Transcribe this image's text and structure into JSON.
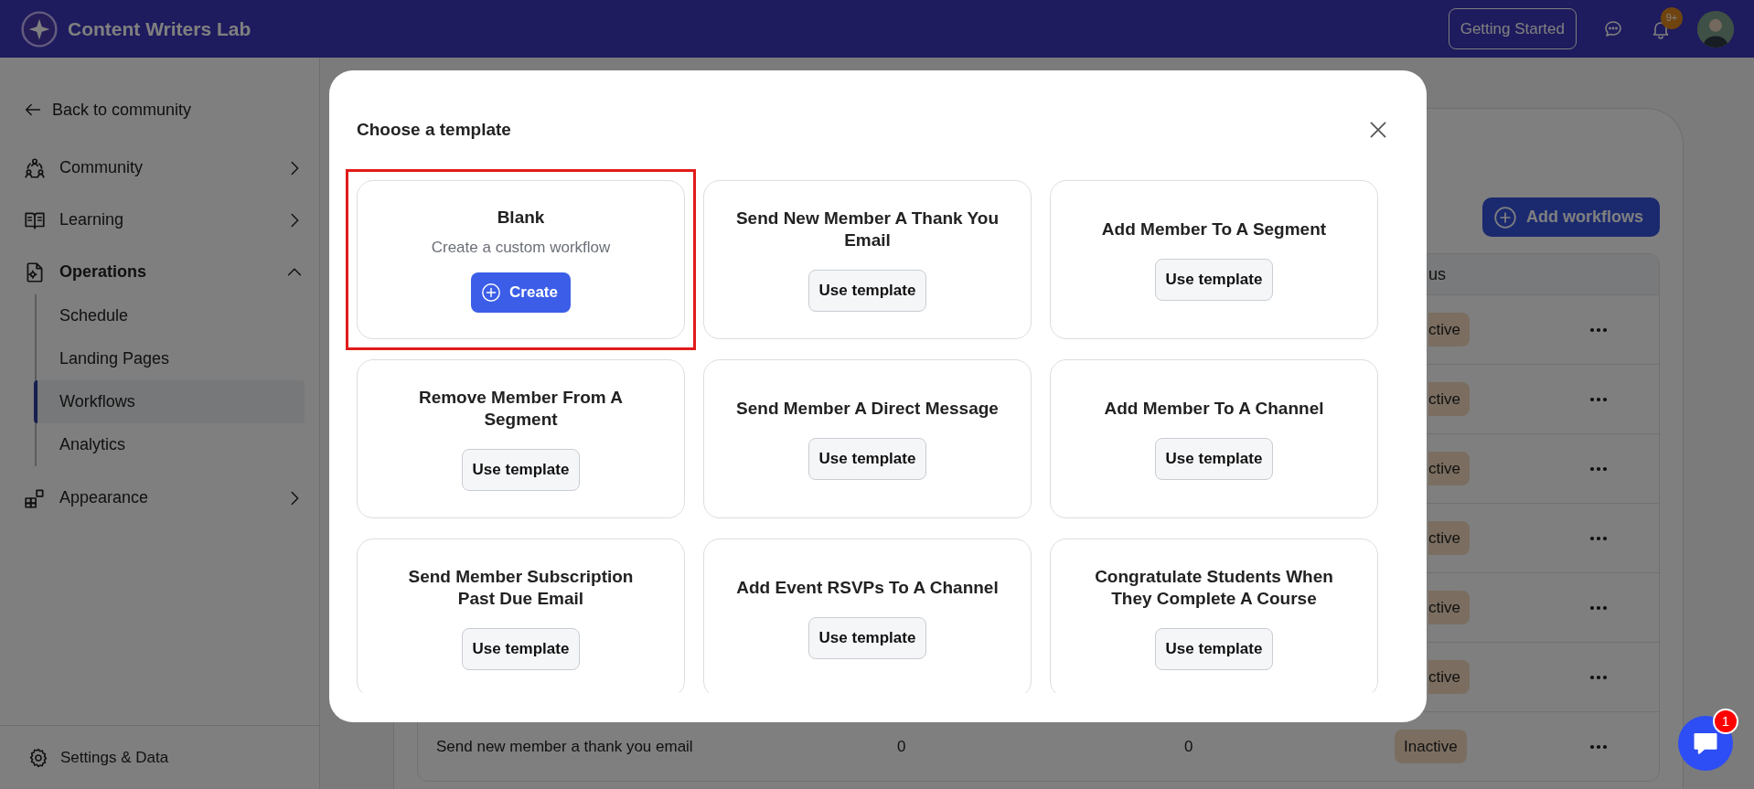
{
  "topbar": {
    "title": "Content Writers Lab",
    "getting_started": "Getting Started",
    "notification_count": "9+"
  },
  "sidebar": {
    "back": "Back to community",
    "items": [
      {
        "label": "Community",
        "expanded": false
      },
      {
        "label": "Learning",
        "expanded": false
      },
      {
        "label": "Operations",
        "expanded": true,
        "children": [
          {
            "label": "Schedule",
            "selected": false
          },
          {
            "label": "Landing Pages",
            "selected": false
          },
          {
            "label": "Workflows",
            "selected": true
          },
          {
            "label": "Analytics",
            "selected": false
          }
        ]
      },
      {
        "label": "Appearance",
        "expanded": false
      }
    ],
    "footer": "Settings & Data"
  },
  "workflows_page": {
    "add_button": "Add workflows",
    "table": {
      "status_header": {
        "label": "us",
        "clipped": true
      },
      "rows": [
        {
          "status": "ctive",
          "clipped": true
        },
        {
          "status": "ctive",
          "clipped": true
        },
        {
          "status": "ctive",
          "clipped": true
        },
        {
          "status": "ctive",
          "clipped": true
        },
        {
          "status": "ctive",
          "clipped": true
        },
        {
          "status": "ctive",
          "clipped": true
        },
        {
          "name": "Send new member a thank you email",
          "column_2": "0",
          "column_3": "0",
          "status": "Inactive",
          "clipped": false
        }
      ]
    }
  },
  "modal": {
    "title": "Choose a template",
    "templates": [
      {
        "kind": "blank",
        "title": "Blank",
        "description": "Create a custom workflow",
        "button": "Create",
        "highlighted": true
      },
      {
        "kind": "template",
        "title": "Send New Member A Thank You Email",
        "button": "Use template",
        "highlighted": false
      },
      {
        "kind": "template",
        "title": "Add Member To A Segment",
        "button": "Use template",
        "highlighted": false
      },
      {
        "kind": "template",
        "title": "Remove Member From A Segment",
        "button": "Use template",
        "highlighted": false
      },
      {
        "kind": "template",
        "title": "Send Member A Direct Message",
        "button": "Use template",
        "highlighted": false
      },
      {
        "kind": "template",
        "title": "Add Member To A Channel",
        "button": "Use template",
        "highlighted": false
      },
      {
        "kind": "template",
        "title": "Send Member Subscription Past Due Email",
        "button": "Use template",
        "highlighted": false
      },
      {
        "kind": "template",
        "title": "Add Event RSVPs To A Channel",
        "button": "Use template",
        "highlighted": false
      },
      {
        "kind": "template",
        "title": "Congratulate Students When They Complete A Course",
        "button": "Use template",
        "highlighted": false
      }
    ]
  },
  "chat": {
    "unread": "1"
  }
}
